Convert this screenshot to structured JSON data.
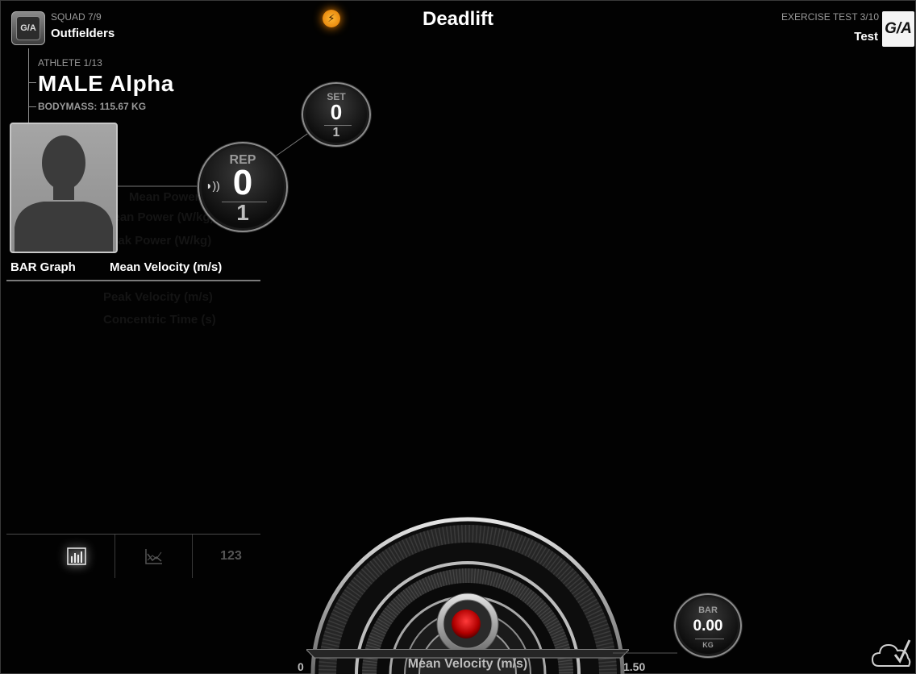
{
  "header": {
    "title": "Deadlift",
    "squad_label": "SQUAD 7/9",
    "squad_name": "Outfielders",
    "exercise_label": "EXERCISE TEST 3/10",
    "exercise_name": "Test",
    "logo_text": "G/A",
    "badge_text": "G/A"
  },
  "athlete": {
    "label": "ATHLETE 1/13",
    "name": "MALE Alpha",
    "bodymass": "BODYMASS: 115.67 KG"
  },
  "set": {
    "label": "SET",
    "value": "0",
    "total": "1"
  },
  "rep": {
    "label": "REP",
    "value": "0",
    "total": "1"
  },
  "bar": {
    "label": "BAR",
    "value": "0.00",
    "unit": "KG"
  },
  "graph": {
    "type_label": "BAR Graph",
    "metric_label": "Mean Velocity (m/s)",
    "ghost_options": [
      "Mean Power (W)",
      "Mean Power (W/kg)",
      "Peak Power (W/kg)",
      "Mean Velocity (m/s)",
      "Peak Velocity (m/s)",
      "Concentric Time (s)"
    ]
  },
  "tabs": [
    {
      "icon": "bar-chart-icon",
      "active": true
    },
    {
      "icon": "line-chart-icon",
      "active": false
    },
    {
      "icon": "numbers-icon",
      "text": "123",
      "active": false
    }
  ],
  "gauge": {
    "label": "Mean Velocity (m/s)",
    "min": "0",
    "max": "1.50",
    "value": 0
  },
  "colors": {
    "background": "#020202",
    "accent_orange": "#ff9a1a",
    "gauge_red": "#d21515",
    "muted_text": "#9a9a9a"
  }
}
